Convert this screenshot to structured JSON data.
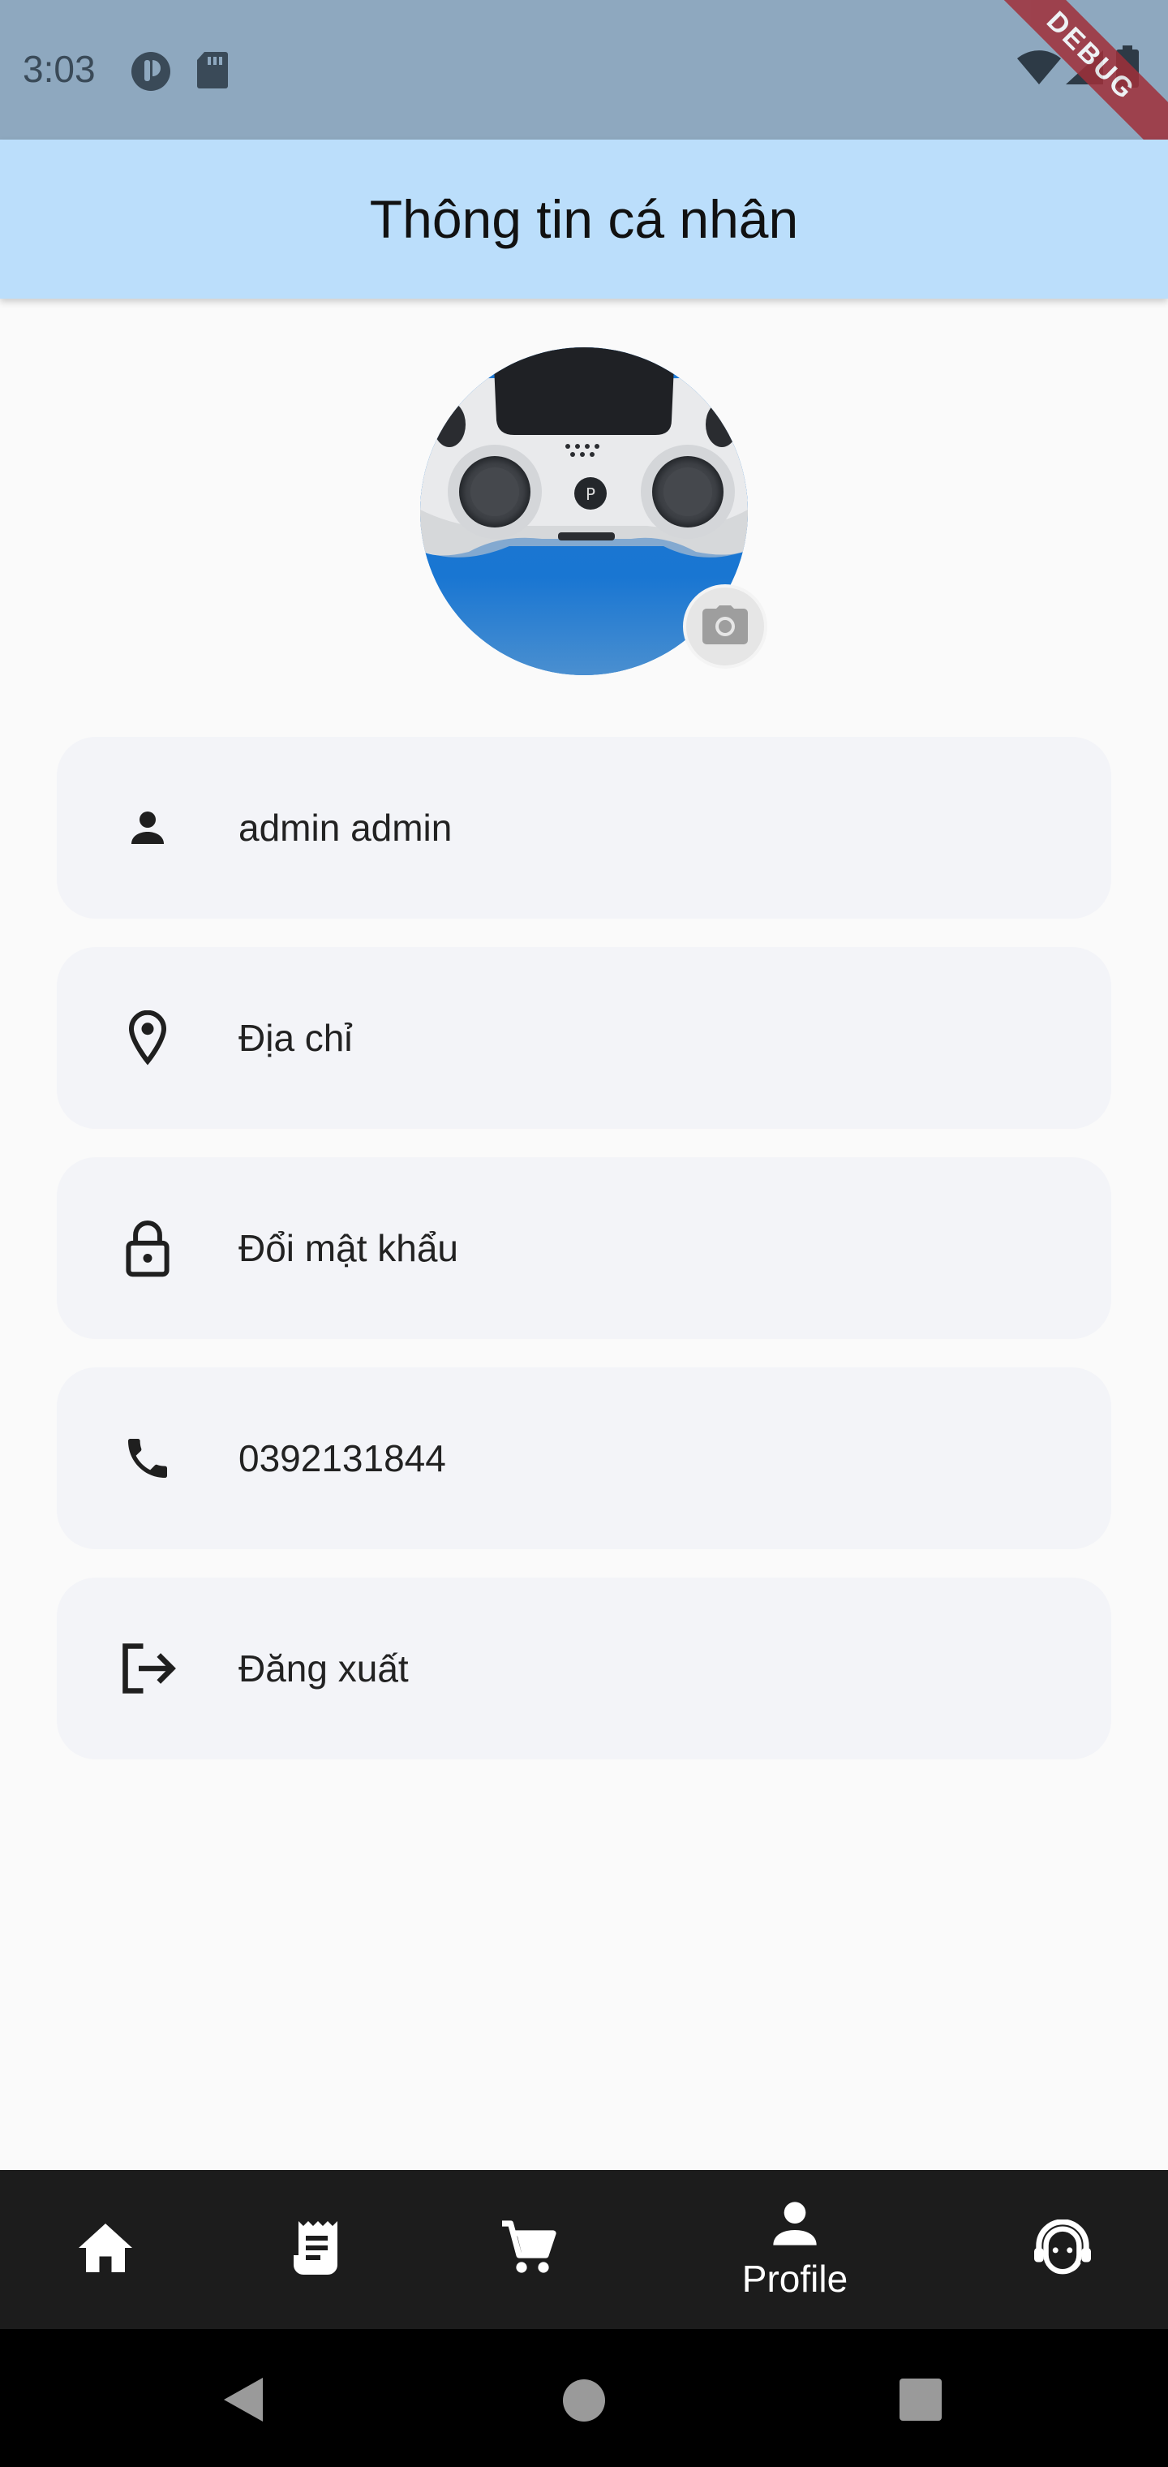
{
  "status_bar": {
    "time": "3:03",
    "debug_label": "DEBUG"
  },
  "app_bar": {
    "title": "Thông tin cá nhân"
  },
  "profile_menu": {
    "items": [
      {
        "icon": "person-icon",
        "label": "admin admin"
      },
      {
        "icon": "location-pin-icon",
        "label": "Địa chỉ"
      },
      {
        "icon": "lock-icon",
        "label": "Đổi mật khẩu"
      },
      {
        "icon": "phone-icon",
        "label": "0392131844"
      },
      {
        "icon": "logout-icon",
        "label": "Đăng xuất"
      }
    ]
  },
  "bottom_nav": {
    "items": [
      {
        "icon": "home-icon",
        "label": ""
      },
      {
        "icon": "receipt-icon",
        "label": ""
      },
      {
        "icon": "cart-icon",
        "label": ""
      },
      {
        "icon": "person-icon",
        "label": "Profile",
        "active": true
      },
      {
        "icon": "support-agent-icon",
        "label": ""
      }
    ]
  },
  "colors": {
    "status_bar": "#8ea8bf",
    "app_bar": "#bbdefb",
    "menu_item_bg": "#f3f4f8",
    "bottom_nav": "#1c1c1c",
    "avatar_accent": "#1976d2"
  }
}
